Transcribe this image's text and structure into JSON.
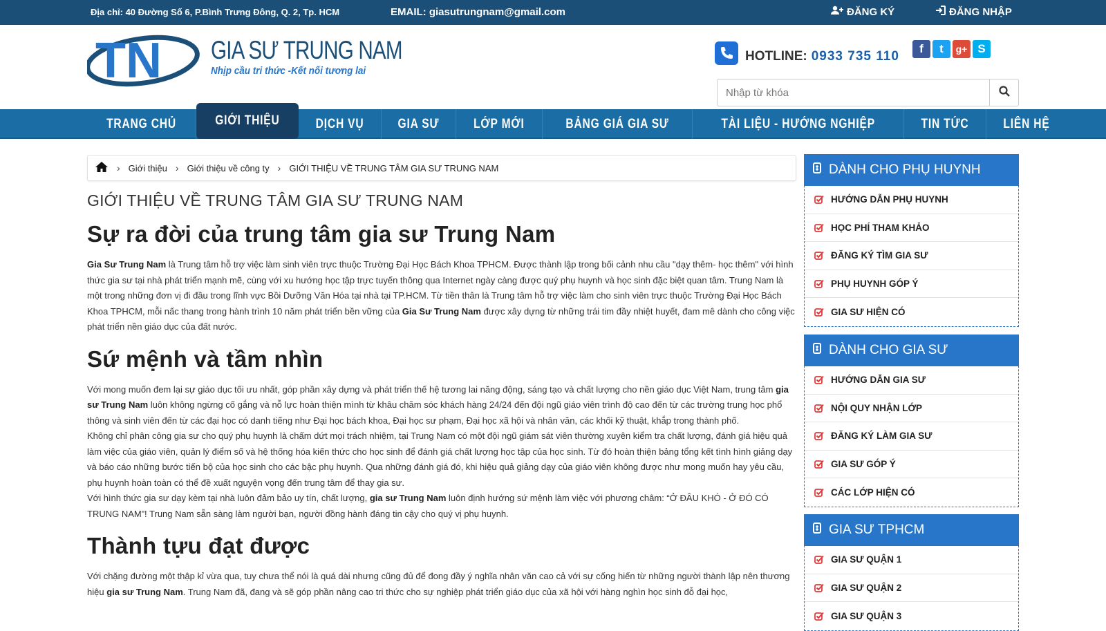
{
  "topbar": {
    "address": "Địa chỉ: 40 Đường Số 6, P.Bình Trưng Đông, Q. 2, Tp. HCM",
    "email": "EMAIL: giasutrungnam@gmail.com",
    "register": "ĐĂNG KÝ",
    "login": "ĐĂNG NHẬP"
  },
  "header": {
    "logo_mark": "TN",
    "brand_name": "GIA SƯ TRUNG NAM",
    "slogan": "Nhịp cầu tri thức -Kết nối tương lai",
    "hotline_label": "HOTLINE:",
    "hotline_number": "0933 735 110",
    "social": [
      {
        "icon": "facebook-icon",
        "glyph": "f",
        "color": "#3b5998"
      },
      {
        "icon": "twitter-icon",
        "glyph": "t",
        "color": "#1da1f2"
      },
      {
        "icon": "google-plus-icon",
        "glyph": "g+",
        "color": "#dd4b39"
      },
      {
        "icon": "skype-icon",
        "glyph": "S",
        "color": "#00aff0"
      }
    ],
    "search_placeholder": "Nhập từ khóa"
  },
  "nav": {
    "items": [
      "TRANG CHỦ",
      "GIỚI THIỆU",
      "DỊCH VỤ",
      "GIA SƯ",
      "LỚP MỚI",
      "BẢNG GIÁ GIA SƯ",
      "TÀI LIỆU - HƯỚNG NGHIỆP",
      "TIN TỨC",
      "LIÊN HỆ"
    ],
    "active_index": 1
  },
  "breadcrumb": {
    "items": [
      "Giới thiệu",
      "Giới thiệu về công ty",
      "GIỚI THIỆU VỀ TRUNG TÂM GIA SƯ TRUNG NAM"
    ]
  },
  "content": {
    "page_title": "GIỚI THIỆU VỀ TRUNG TÂM GIA SƯ TRUNG NAM",
    "h_birth": "Sự ra đời của trung tâm gia sư Trung Nam",
    "p1_b1": "Gia Sư Trung Nam",
    "p1_t1": " là Trung tâm hỗ trợ việc làm sinh viên trực thuộc Trường Đại Học Bách Khoa TPHCM.  Được thành lập trong bối cảnh nhu cầu \"dạy thêm- học thêm\" với hình thức gia sư tại nhà phát triển mạnh mẽ, cùng với xu hướng học tập trực tuyến thông qua Internet ngày càng được quý phụ huynh và học sinh đặc biệt quan tâm. Trung Nam là một trong những đơn vị đi đầu trong lĩnh vực Bồi Dưỡng Văn Hóa tại nhà tại TP.HCM. Từ tiền thân là Trung tâm hỗ trợ việc làm cho sinh viên trực thuộc Trường Đại Học Bách Khoa TPHCM, mỗi nấc thang trong hành trình 10 năm phát triển bền vững của ",
    "p1_b2": "Gia Sư Trung Nam",
    "p1_t2": " được xây dựng từ những trái tim đầy nhiệt huyết, đam mê dành cho công việc phát triển nền giáo dục của đất nước.",
    "h_mission": "Sứ mệnh và tầm nhìn",
    "p2_t1": "Với mong muốn đem lại sự giáo dục tối ưu nhất, góp phần xây dựng và phát triển thế hệ tương lai năng động, sáng tạo và chất lượng cho nền giáo dục Việt Nam, trung tâm ",
    "p2_b1": "gia sư Trung Nam",
    "p2_t2": " luôn không ngừng cố gắng và nỗ lực hoàn thiện mình từ khâu chăm sóc khách hàng 24/24 đến đội ngũ giáo viên trình độ cao đến từ các trường trung học phổ thông và sinh viên đến từ các đại học có danh tiếng như Đại học bách khoa, Đại học sư phạm, Đại học xã hội và nhân văn, các khối kỹ thuật, khắp trong thành phố.",
    "p3": "Không chỉ phân công gia sư cho quý phụ huynh là chấm dứt mọi trách nhiệm, tại Trung Nam có một đội ngũ giám sát viên thường xuyên kiểm tra chất lượng, đánh giá hiệu quả làm việc của giáo viên, quản lý điểm số và hệ thống hóa kiến thức cho học sinh để đánh giá chất lượng học tập của học sinh. Từ đó hoàn thiện bảng tổng kết tình hình giảng dạy và báo cáo những bước tiến bộ của học sinh cho các bậc phụ huynh. Qua những đánh giá đó, khi hiệu quả giảng dạy của giáo viên không được như mong muốn hay yêu cầu, phụ huynh hoàn toàn có thể đề xuất nguyện vọng đến trung tâm để thay gia sư.",
    "p4_t1": "Với hình thức gia sư dạy kèm tại nhà luôn đảm bảo uy tín, chất lượng, ",
    "p4_b1": "gia sư Trung Nam",
    "p4_t2": " luôn định hướng sứ mệnh làm việc với phương châm: “Ở ĐÂU KHÓ - Ở ĐÓ CÓ TRUNG NAM”! Trung Nam sẵn sàng làm người bạn, người đồng hành đáng tin cậy cho quý vị phụ huynh.",
    "h_achieve": "Thành tựu đạt được",
    "p5_t1": "Với chặng đường một thập kỉ vừa qua, tuy chưa thể nói là quá dài nhưng cũng đủ để đong đầy ý nghĩa nhân văn cao cả với sự cống hiến từ những người thành lập nên thương hiệu ",
    "p5_b1": "gia sư Trung Nam",
    "p5_t2": ". Trung Nam đã, đang và sẽ góp phần nâng cao tri thức cho sự nghiệp phát triển giáo dục của xã hội với hàng nghìn học sinh đỗ đại học,"
  },
  "sidebar": [
    {
      "title": "DÀNH CHO PHỤ HUYNH",
      "items": [
        "HƯỚNG DẪN PHỤ HUYNH",
        "HỌC PHÍ THAM KHẢO",
        "ĐĂNG KÝ TÌM GIA SƯ",
        "PHỤ HUYNH GÓP Ý",
        "GIA SƯ HIỆN CÓ"
      ]
    },
    {
      "title": "DÀNH CHO GIA SƯ",
      "items": [
        "HƯỚNG DẪN GIA SƯ",
        "NỘI QUY NHẬN LỚP",
        "ĐĂNG KÝ LÀM GIA SƯ",
        "GIA SƯ GÓP Ý",
        "CÁC LỚP HIỆN CÓ"
      ]
    },
    {
      "title": "GIA SƯ TPHCM",
      "items": [
        "GIA SƯ QUẬN 1",
        "GIA SƯ QUẬN 2",
        "GIA SƯ QUẬN 3"
      ]
    }
  ],
  "colors": {
    "topbar": "#1b4f78",
    "nav": "#1b6ea5",
    "nav_active": "#163f63",
    "sidebar_head": "#2876c9",
    "check": "#e03b3b"
  }
}
